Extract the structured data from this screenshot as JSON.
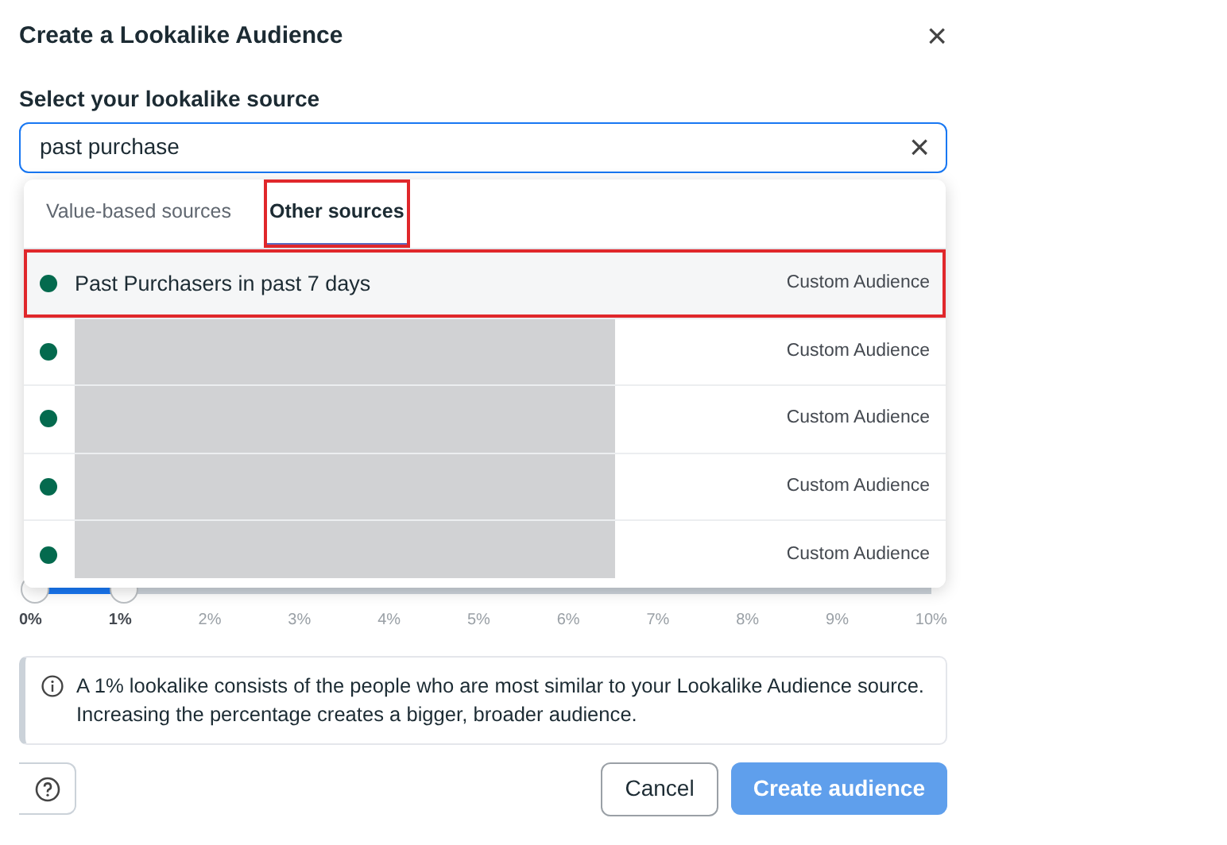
{
  "dialog": {
    "title": "Create a Lookalike Audience",
    "close": "×"
  },
  "source": {
    "label": "Select your lookalike source",
    "value": "past purchase",
    "clear": "×"
  },
  "dropdown": {
    "tabs": [
      {
        "label": "Value-based sources",
        "selected": false
      },
      {
        "label": "Other sources",
        "selected": true,
        "highlighted": true
      }
    ],
    "items": [
      {
        "name": "Past Purchasers in past 7 days",
        "type": "Custom Audience",
        "color": "#046a4e",
        "highlighted": true
      },
      {
        "type": "Custom Audience",
        "color": "#046a4e",
        "redacted": true
      },
      {
        "type": "Custom Audience",
        "color": "#046a4e",
        "redacted": true
      },
      {
        "type": "Custom Audience",
        "color": "#046a4e",
        "redacted": true
      },
      {
        "type": "Custom Audience",
        "color": "#046a4e",
        "redacted": true
      }
    ]
  },
  "size_slider": {
    "level": 0.1,
    "ticks": [
      {
        "label": "0%",
        "active": true
      },
      {
        "label": "1%",
        "active": true
      },
      {
        "label": "2%",
        "active": false
      },
      {
        "label": "3%",
        "active": false
      },
      {
        "label": "4%",
        "active": false
      },
      {
        "label": "5%",
        "active": false
      },
      {
        "label": "6%",
        "active": false
      },
      {
        "label": "7%",
        "active": false
      },
      {
        "label": "8%",
        "active": false
      },
      {
        "label": "9%",
        "active": false
      },
      {
        "label": "10%",
        "active": false
      }
    ]
  },
  "info": "A 1% lookalike consists of the people who are most similar to your Lookalike Audience source. Increasing the percentage creates a bigger, broader audience.",
  "buttons": [
    {
      "label": "Cancel",
      "kind": "secondary"
    },
    {
      "label": "Create audience",
      "kind": "primary",
      "disabled": true
    }
  ]
}
